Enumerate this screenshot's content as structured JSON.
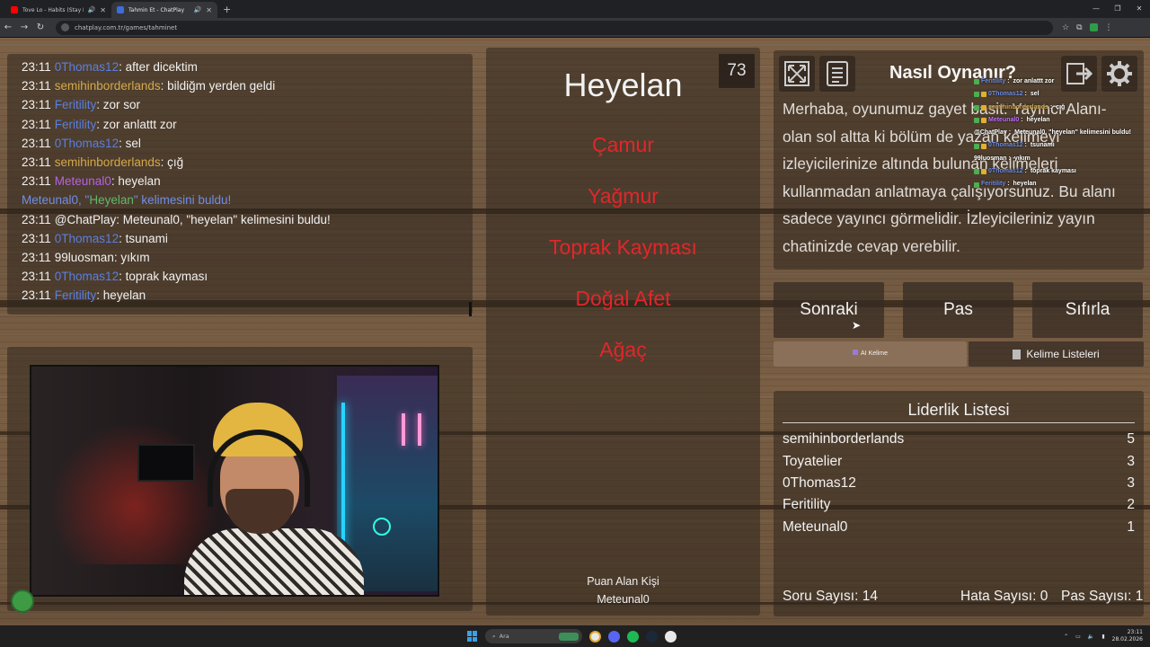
{
  "browser": {
    "tabs": [
      {
        "title": "Tove Lo - Habits (Stay High)",
        "active": false,
        "favicon_color": "#ff0000"
      },
      {
        "title": "Tahmin Et - ChatPlay",
        "active": true,
        "favicon_color": "#3b6fd8"
      }
    ],
    "url": "chatplay.com.tr/games/tahminet"
  },
  "chat": {
    "lines": [
      {
        "time": "23:11",
        "user": "0Thomas12",
        "color": "u-blue",
        "msg": "after dicektim"
      },
      {
        "time": "23:11",
        "user": "semihinborderlands",
        "color": "u-gold",
        "msg": "bildiğm yerden geldi"
      },
      {
        "time": "23:11",
        "user": "Feritility",
        "color": "u-blue",
        "msg": "zor sor"
      },
      {
        "time": "23:11",
        "user": "Feritility",
        "color": "u-blue",
        "msg": "zor anlattt zor"
      },
      {
        "time": "23:11",
        "user": "0Thomas12",
        "color": "u-blue",
        "msg": "sel"
      },
      {
        "time": "23:11",
        "user": "semihinborderlands",
        "color": "u-gold",
        "msg": "çığ"
      },
      {
        "time": "23:11",
        "user": "Meteunal0",
        "color": "u-purple",
        "msg": "heyelan"
      },
      {
        "system": true,
        "pre": "Meteunal0, \"",
        "word": "Heyelan",
        "post": "\" kelimesini buldu!"
      },
      {
        "time": "23:11",
        "user": "@ChatPlay",
        "color": "u-white",
        "msg": "Meteunal0, \"heyelan\" kelimesini buldu!"
      },
      {
        "time": "23:11",
        "user": "0Thomas12",
        "color": "u-blue",
        "msg": "tsunami"
      },
      {
        "time": "23:11",
        "user": "99luosman",
        "color": "u-white",
        "msg": "yıkım"
      },
      {
        "time": "23:11",
        "user": "0Thomas12",
        "color": "u-blue",
        "msg": "toprak kayması"
      },
      {
        "time": "23:11",
        "user": "Feritility",
        "color": "u-blue",
        "msg": "heyelan"
      }
    ]
  },
  "game": {
    "timer": "73",
    "word": "Heyelan",
    "forbidden": [
      "Çamur",
      "Yağmur",
      "Toprak Kayması",
      "Doğal Afet",
      "Ağaç"
    ],
    "scorer_label": "Puan Alan Kişi",
    "scorer_name": "Meteunal0",
    "forbidden_color": "#e2262a"
  },
  "howto": {
    "title": "Nasıl Oynanır?",
    "text": "Merhaba, oyunumuz gayet basit. Yayıncı Alanı-olan sol altta ki bölüm de yazan kelimeyi izleyicilerinize altında bulunan kelimeleri kullanmadan anlatmaya çalışıyorsunuz. Bu alanı sadece yayıncı görmelidir. İzleyicileriniz yayın chatinizde cevap verebilir.",
    "icons": [
      "fullscreen-icon",
      "document-icon",
      "exit-icon",
      "gear-icon"
    ]
  },
  "minichat": [
    {
      "user": "Feritility",
      "msg": "zor anlattt zor",
      "color": "#6f8ee8"
    },
    {
      "user": "0Thomas12",
      "msg": "sel",
      "color": "#6f8ee8"
    },
    {
      "user": "semihinborderlands",
      "msg": "çığ",
      "color": "#d4a94a"
    },
    {
      "user": "Meteunal0",
      "msg": "heyelan",
      "color": "#c070ff"
    },
    {
      "user": "@ChatPlay",
      "msg": "Meteunal0, \"heyelan\" kelimesini buldu!",
      "color": "#ffffff"
    },
    {
      "user": "0Thomas12",
      "msg": "tsunami",
      "color": "#6f8ee8"
    },
    {
      "user": "99luosman",
      "msg": "yıkım",
      "color": "#ffffff"
    },
    {
      "user": "0Thomas12",
      "msg": "toprak kayması",
      "color": "#6f8ee8"
    },
    {
      "user": "Feritility",
      "msg": "heyelan",
      "color": "#6f8ee8"
    }
  ],
  "controls": {
    "next": "Sonraki",
    "pass": "Pas",
    "reset": "Sıfırla",
    "ai_words": "AI Kelime",
    "word_lists": "Kelime Listeleri"
  },
  "leaderboard": {
    "title": "Liderlik Listesi",
    "rows": [
      {
        "name": "semihinborderlands",
        "score": "5"
      },
      {
        "name": "Toyatelier",
        "score": "3"
      },
      {
        "name": "0Thomas12",
        "score": "3"
      },
      {
        "name": "Feritility",
        "score": "2"
      },
      {
        "name": "Meteunal0",
        "score": "1"
      }
    ],
    "question_count": "Soru Sayısı: 14",
    "error_count": "Hata Sayısı: 0",
    "pass_count": "Pas Sayısı: 1"
  },
  "taskbar": {
    "search": "Ara",
    "time": "23:11",
    "date": "28.02.2026"
  }
}
